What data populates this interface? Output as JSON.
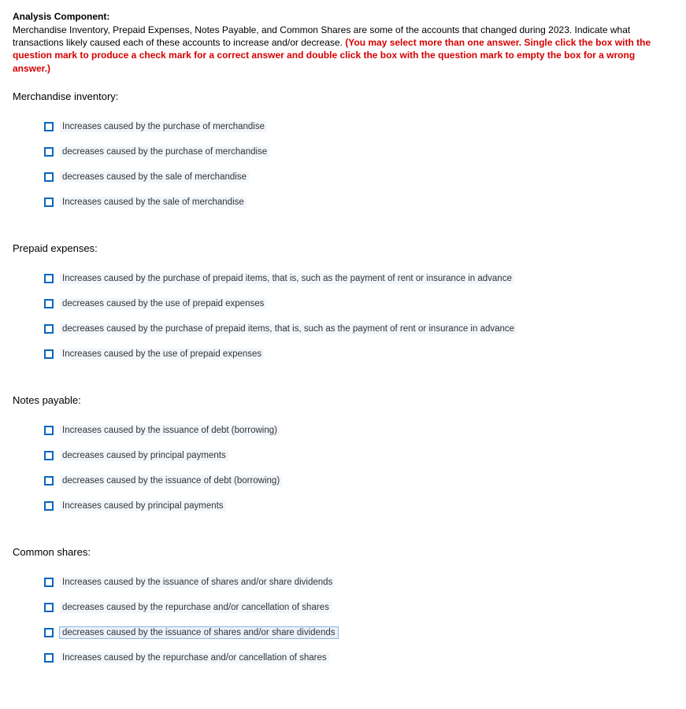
{
  "header": {
    "title": "Analysis Component:",
    "intro_plain_1": "Merchandise Inventory, Prepaid Expenses, Notes Payable, and Common Shares are some of the accounts that changed during 2023. Indicate what transactions likely caused each of these accounts to increase and/or decrease. ",
    "intro_red": "(You may select more than one answer. Single click the box with the question mark to produce a check mark for a correct answer and double click the box with the question mark to empty the box for a wrong answer.)"
  },
  "sections": {
    "merch": {
      "label": "Merchandise inventory:",
      "options": [
        "Increases caused by the purchase of merchandise",
        "decreases caused by the purchase of merchandise",
        "decreases caused by the sale of merchandise",
        "Increases caused by the sale of merchandise"
      ]
    },
    "prepaid": {
      "label": "Prepaid expenses:",
      "options": [
        "Increases caused by the purchase of prepaid items, that is, such as the payment of rent or insurance in advance",
        "decreases caused by the use of prepaid expenses",
        "decreases caused by the purchase of prepaid items, that is, such as the payment of rent or insurance in advance",
        "Increases caused by the use of prepaid expenses"
      ]
    },
    "notes": {
      "label": "Notes payable:",
      "options": [
        "Increases caused by the issuance of debt (borrowing)",
        "decreases caused by principal payments",
        "decreases caused by the issuance of debt (borrowing)",
        "Increases caused by principal payments"
      ]
    },
    "common": {
      "label": "Common shares:",
      "options": [
        "Increases caused by the issuance of shares and/or share dividends",
        "decreases caused by the repurchase and/or cancellation of shares",
        "decreases caused by the issuance of shares and/or share dividends",
        "Increases caused by the repurchase and/or cancellation of shares"
      ]
    }
  }
}
